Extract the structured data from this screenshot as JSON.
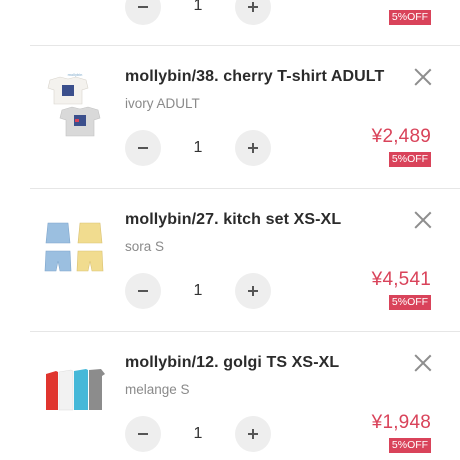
{
  "colors": {
    "price": "#d9435a",
    "badge_bg": "#d9435a",
    "stepper_bg": "#eeeeee",
    "divider": "#e6e6e6"
  },
  "icons": {
    "minus": "minus-icon",
    "plus": "plus-icon",
    "remove": "close-icon"
  },
  "cart": {
    "items": [
      {
        "qty": "1",
        "discount": "5%OFF"
      },
      {
        "name": "mollybin/38. cherry T-shirt ADULT",
        "variant": "ivory ADULT",
        "qty": "1",
        "price": "¥2,489",
        "discount": "5%OFF"
      },
      {
        "name": "mollybin/27. kitch set XS-XL",
        "variant": "sora S",
        "qty": "1",
        "price": "¥4,541",
        "discount": "5%OFF"
      },
      {
        "name": "mollybin/12. golgi TS XS-XL",
        "variant": "melange S",
        "qty": "1",
        "price": "¥1,948",
        "discount": "5%OFF"
      }
    ]
  }
}
